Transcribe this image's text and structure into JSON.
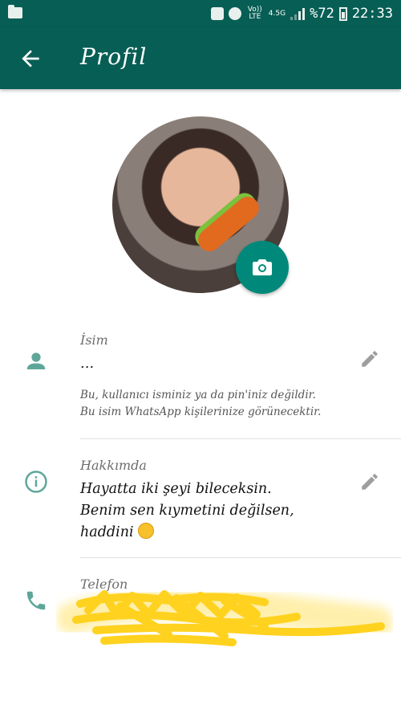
{
  "status_bar": {
    "network_label": "Vo)) LTE",
    "network_type": "4.5G",
    "battery": "%72",
    "time": "22:33"
  },
  "app_bar": {
    "title": "Profil"
  },
  "name_section": {
    "label": "İsim",
    "value": "...",
    "hint_line1": "Bu, kullanıcı isminiz ya da pin'iniz değildir.",
    "hint_line2": "Bu isim WhatsApp kişilerinize görünecektir."
  },
  "about_section": {
    "label": "Hakkımda",
    "line1": "Hayatta iki şeyi bileceksin.",
    "line2": "Benim sen kıymetini değilsen,",
    "line3": "haddini"
  },
  "phone_section": {
    "label": "Telefon"
  },
  "colors": {
    "primary_dark": "#075e54",
    "accent": "#00897b",
    "icon_teal": "#5fa69a"
  }
}
